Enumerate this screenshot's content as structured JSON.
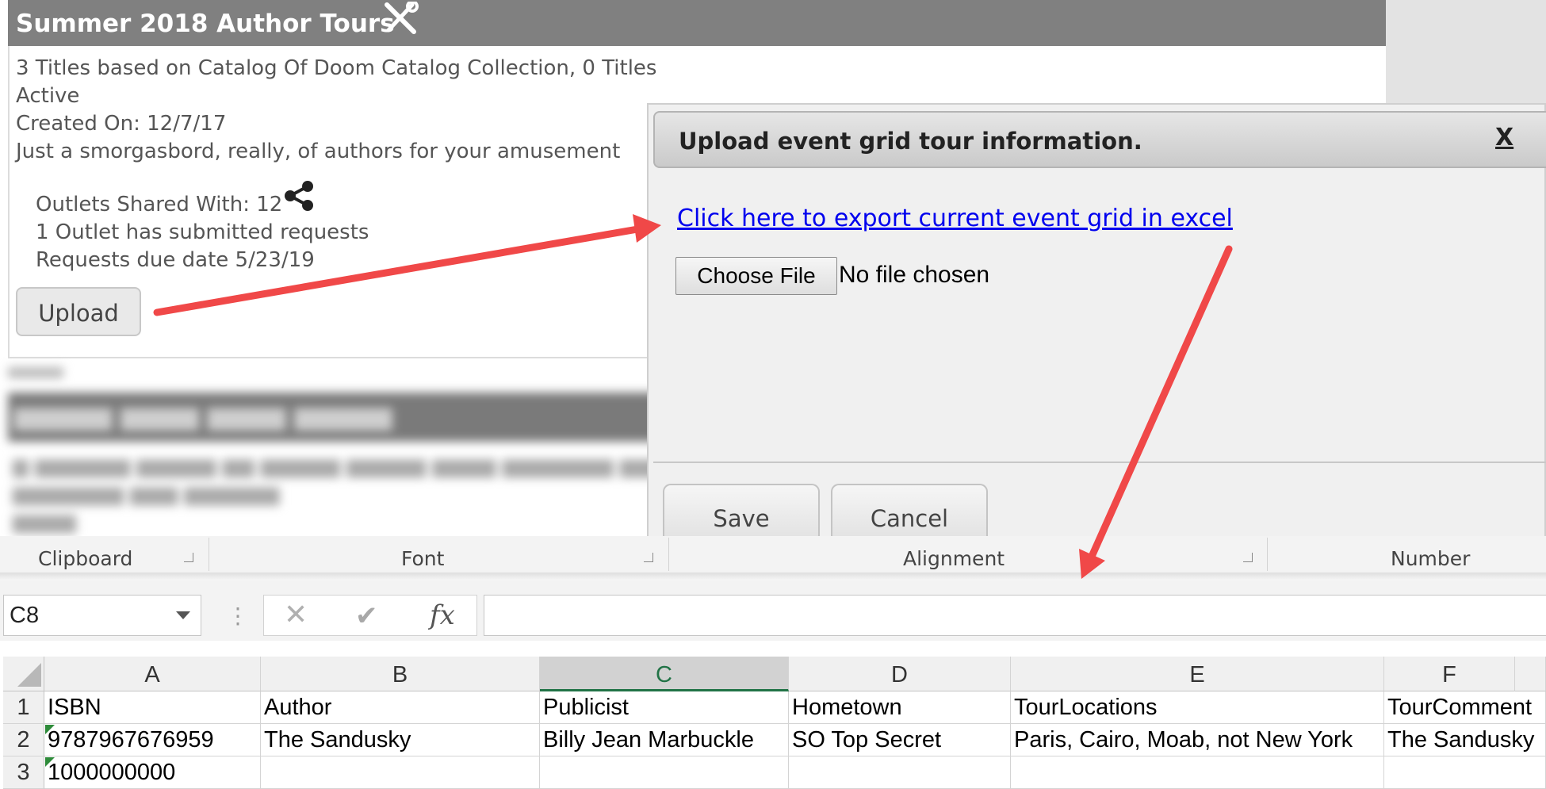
{
  "collection": {
    "title": "Summer 2018 Author Tours",
    "titles_line1": "3 Titles based on Catalog Of Doom Catalog Collection, 0 Titles",
    "titles_line2": "Active",
    "created": "Created On: 12/7/17",
    "description": "Just a smorgasbord, really, of authors for your amusement",
    "outlets_shared": "Outlets Shared With: 12",
    "outlet_requests": "1 Outlet has submitted requests",
    "requests_due": "Requests due date 5/23/19",
    "upload_label": "Upload"
  },
  "modal": {
    "title": "Upload event grid tour information.",
    "close_label": "X",
    "export_link": "Click here to export current event grid in excel",
    "choose_file_label": "Choose File",
    "file_status": "No file chosen",
    "save_label": "Save",
    "cancel_label": "Cancel"
  },
  "excel": {
    "ribbon_groups": [
      "Clipboard",
      "Font",
      "Alignment",
      "Number"
    ],
    "name_box": "C8",
    "formula_value": "",
    "columns": [
      "A",
      "B",
      "C",
      "D",
      "E",
      "F"
    ],
    "selected_column": "C",
    "rows": [
      {
        "num": "1",
        "cells": [
          "ISBN",
          "Author",
          "Publicist",
          "Hometown",
          "TourLocations",
          "TourComment"
        ]
      },
      {
        "num": "2",
        "cells": [
          "9787967676959",
          "The Sandusky",
          "Billy Jean Marbuckle",
          "SO Top Secret",
          "Paris, Cairo, Moab, not New York",
          "The Sandusky"
        ]
      },
      {
        "num": "3",
        "cells": [
          "1000000000",
          "",
          "",
          "",
          "",
          ""
        ]
      }
    ]
  },
  "annotations": {
    "arrow_color": "#f04848"
  }
}
